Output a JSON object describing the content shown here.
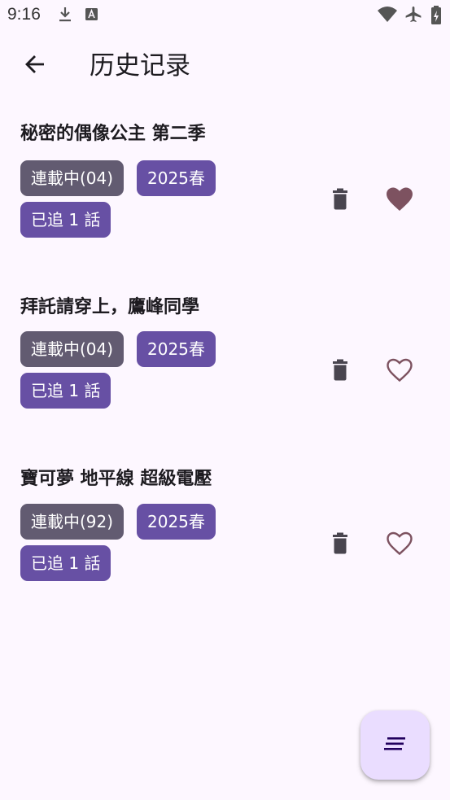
{
  "status_bar": {
    "time": "9:16",
    "icons": [
      "download-icon",
      "font-icon",
      "wifi-icon",
      "airplane-icon",
      "battery-icon"
    ]
  },
  "header": {
    "title": "历史记录",
    "back_icon": "arrow-back-icon"
  },
  "items": [
    {
      "title": "秘密的偶像公主 第二季",
      "status": "連載中(04)",
      "season": "2025春",
      "watched": "已追 1 話",
      "favorite": true
    },
    {
      "title": "拜託請穿上，鷹峰同學",
      "status": "連載中(04)",
      "season": "2025春",
      "watched": "已追 1 話",
      "favorite": false
    },
    {
      "title": "寶可夢 地平線 超級電壓",
      "status": "連載中(92)",
      "season": "2025春",
      "watched": "已追 1 話",
      "favorite": false
    }
  ],
  "fab": {
    "icon": "sort-icon"
  },
  "colors": {
    "background": "#fdf7ff",
    "chip_status": "#625b71",
    "chip_primary": "#6750a4",
    "favorite": "#7d5260",
    "fab_bg": "#eaddff"
  }
}
